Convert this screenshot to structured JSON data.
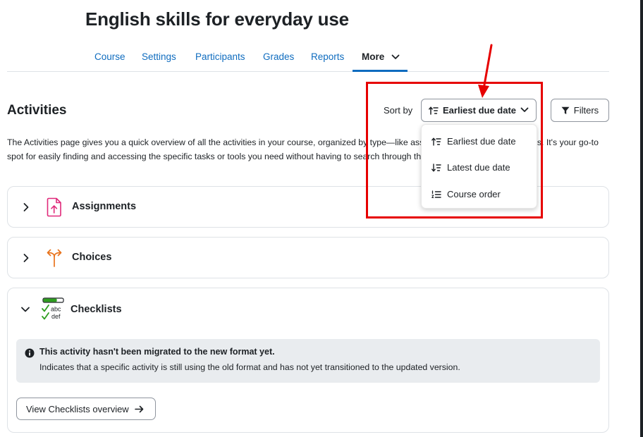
{
  "course": {
    "title": "English skills for everyday use"
  },
  "nav": {
    "items": [
      {
        "label": "Course"
      },
      {
        "label": "Settings"
      },
      {
        "label": "Participants"
      },
      {
        "label": "Grades"
      },
      {
        "label": "Reports"
      },
      {
        "label": "More"
      }
    ]
  },
  "activities": {
    "heading": "Activities",
    "intro": "The Activities page gives you a quick overview of all the activities in your course, organized by type—like assignments, quizzes, and forums. It's your go-to spot for easily finding and accessing the specific tasks or tools you need without having to search through the whole course."
  },
  "sort": {
    "label": "Sort by",
    "selected": "Earliest due date",
    "options": [
      {
        "label": "Earliest due date"
      },
      {
        "label": "Latest due date"
      },
      {
        "label": "Course order"
      }
    ]
  },
  "filters": {
    "label": "Filters"
  },
  "sections": [
    {
      "title": "Assignments",
      "expanded": false
    },
    {
      "title": "Choices",
      "expanded": false
    },
    {
      "title": "Checklists",
      "expanded": true,
      "notice": {
        "title": "This activity hasn't been migrated to the new format yet.",
        "body": "Indicates that a specific activity is still using the old format and has not yet transitioned to the updated version."
      },
      "overview_button": "View Checklists overview"
    }
  ],
  "checklist_icon": {
    "line1": "abc",
    "line2": "def"
  },
  "colors": {
    "link": "#0f6cbf",
    "text": "#1d2125",
    "annotation": "#e60000",
    "assignment_icon": "#e0297a",
    "choice_icon": "#e8731c",
    "checklist_green": "#2e9e1f"
  }
}
